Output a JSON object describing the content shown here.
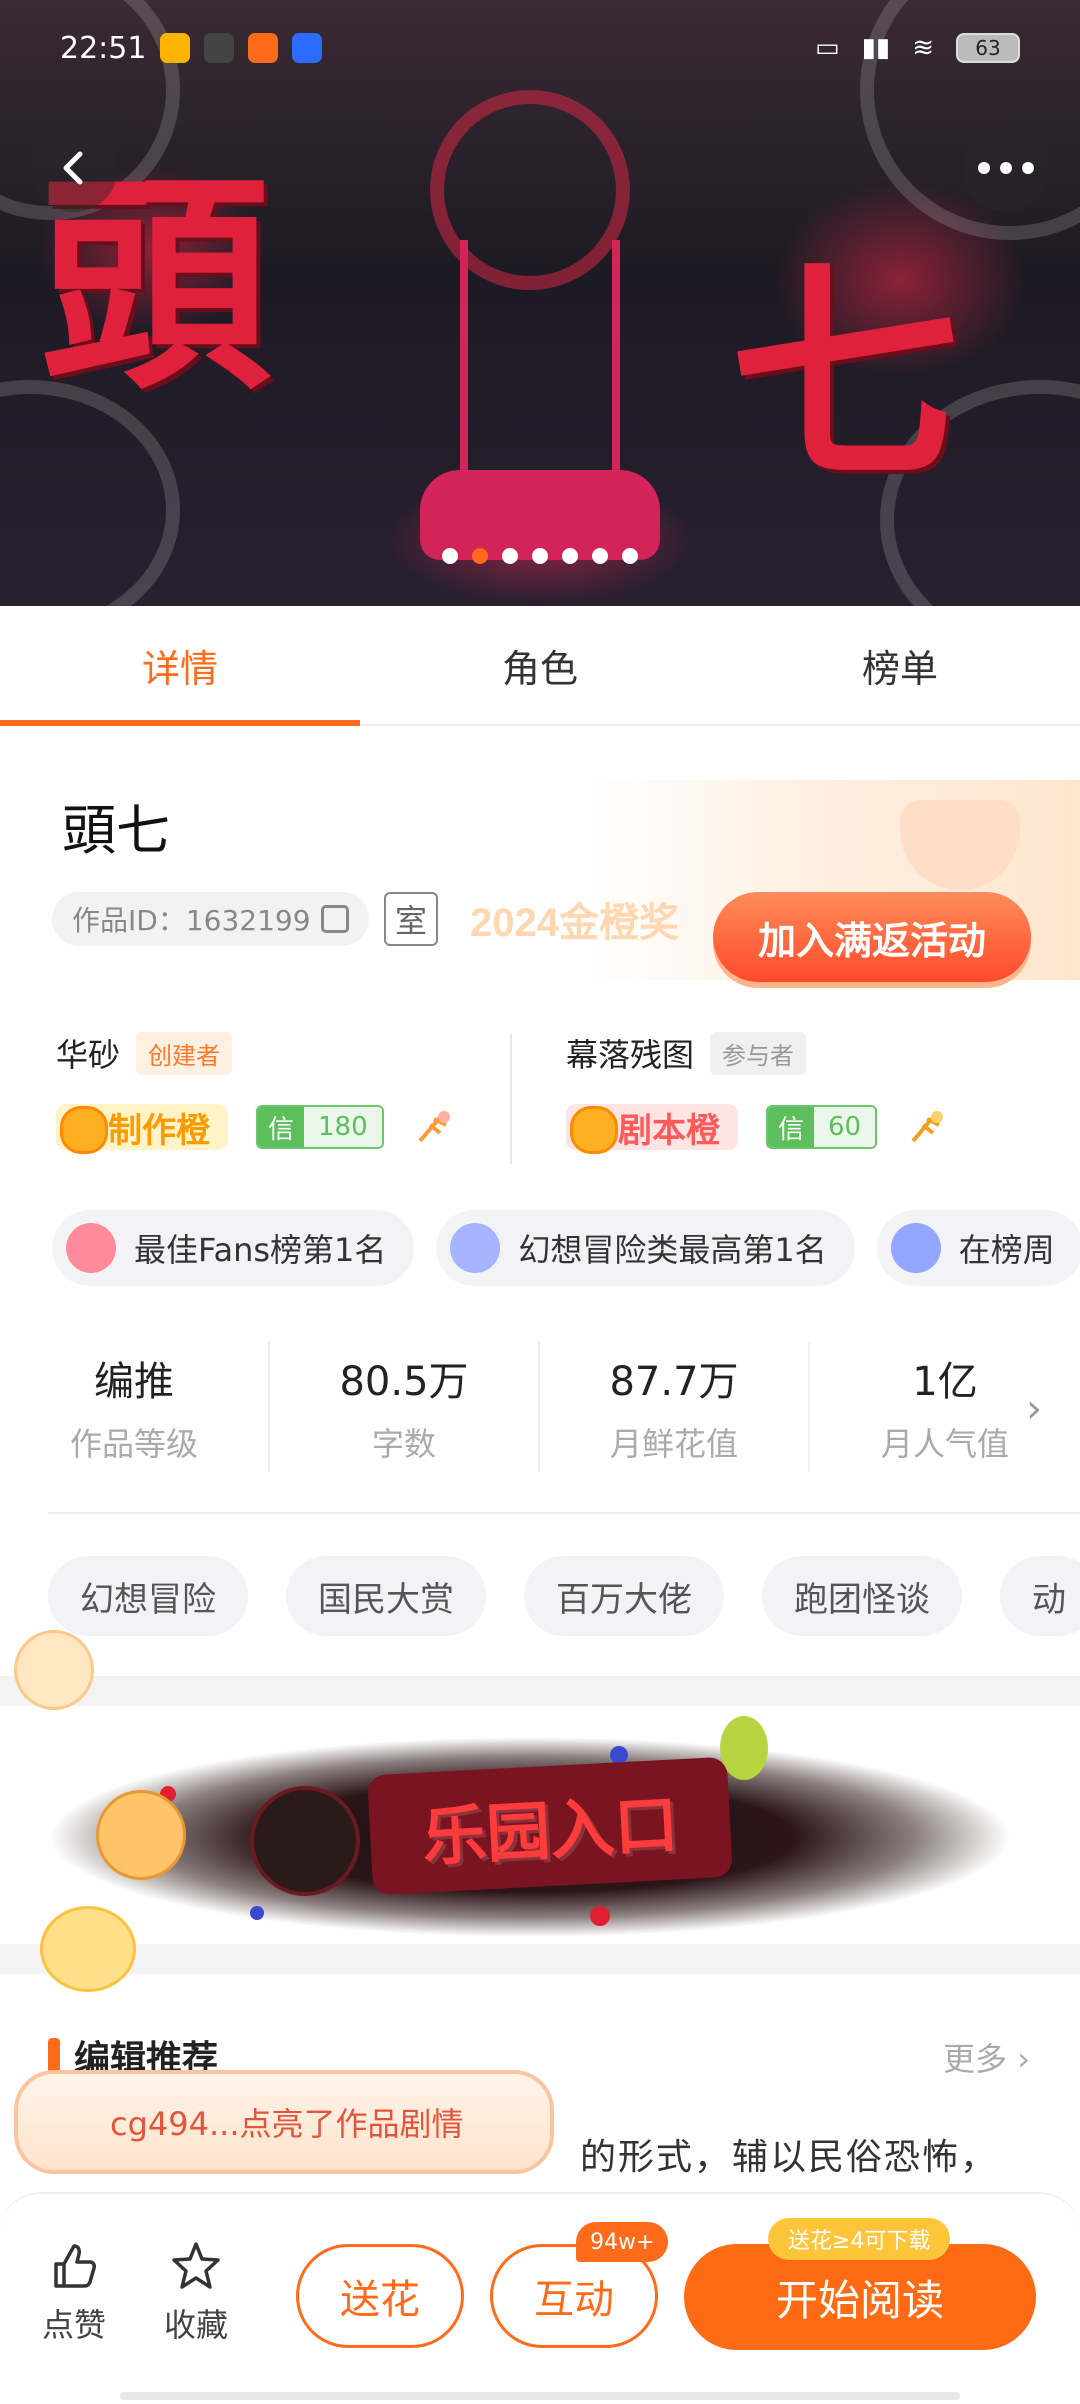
{
  "status_bar": {
    "time": "22:51",
    "battery": "63"
  },
  "hero": {
    "title_chars": [
      "頭",
      "七"
    ],
    "carousel_count": 7,
    "carousel_active": 1
  },
  "tabs": [
    {
      "label": "详情",
      "active": true
    },
    {
      "label": "角色",
      "active": false
    },
    {
      "label": "榜单",
      "active": false
    }
  ],
  "work": {
    "title": "頭七",
    "id_text": "作品ID：1632199",
    "room_icon_label": "室"
  },
  "promo": {
    "year_text": "2024金橙奖",
    "button_label": "加入满返活动"
  },
  "authors": [
    {
      "name": "华砂",
      "role": "创建者",
      "level": "制作橙",
      "xin_label": "信",
      "xin_value": "180"
    },
    {
      "name": "幕落残图",
      "role": "参与者",
      "level": "剧本橙",
      "xin_label": "信",
      "xin_value": "60"
    }
  ],
  "honors": [
    {
      "text": "最佳Fans榜第1名",
      "icon_color": "#ff7a8a"
    },
    {
      "text": "幻想冒险类最高第1名",
      "icon_color": "#9aa8ff"
    },
    {
      "text": "在榜周",
      "icon_color": "#8aa0ff"
    }
  ],
  "stats": [
    {
      "value": "编推",
      "label": "作品等级"
    },
    {
      "value": "80.5万",
      "label": "字数"
    },
    {
      "value": "87.7万",
      "label": "月鲜花值"
    },
    {
      "value": "1亿",
      "label": "月人气值"
    }
  ],
  "tags": [
    "幻想冒险",
    "国民大赏",
    "百万大佬",
    "跑团怪谈",
    "动"
  ],
  "paradise": {
    "label": "乐园入口"
  },
  "recommend": {
    "title": "编辑推荐",
    "more": "更多",
    "text": "的形式，辅以民俗恐怖，"
  },
  "toast": {
    "text": "cg494...点亮了作品剧情"
  },
  "bottom": {
    "like_label": "点赞",
    "fav_label": "收藏",
    "flower_label": "送花",
    "interact_label": "互动",
    "interact_count": "94w+",
    "read_label": "开始阅读",
    "read_hint": "送花≥4可下载"
  },
  "colors": {
    "accent": "#ff6b1a",
    "hero_red": "#e0213c",
    "green": "#5cbf5c"
  }
}
